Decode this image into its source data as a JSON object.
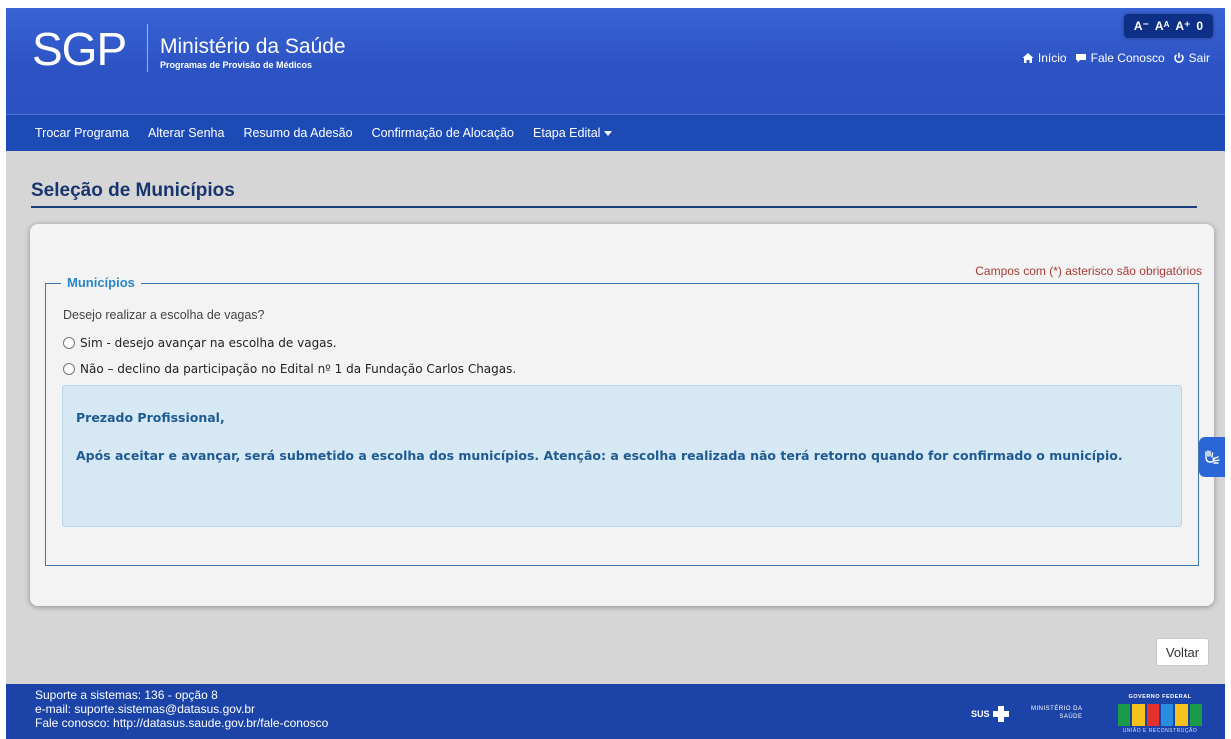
{
  "header": {
    "logo": "SGP",
    "title": "Ministério da Saúde",
    "subtitle": "Programas de Provisão de Médicos",
    "font_controls": [
      "A⁻",
      "Aᴬ",
      "A⁺",
      "0"
    ],
    "links": {
      "home": "Início",
      "contact": "Fale Conosco",
      "logout": "Sair"
    }
  },
  "nav": {
    "items": [
      "Trocar Programa",
      "Alterar Senha",
      "Resumo da Adesão",
      "Confirmação de Alocação",
      "Etapa Edital"
    ]
  },
  "page": {
    "title": "Seleção de Municípios",
    "required_note": "Campos com (*) asterisco são obrigatórios",
    "fieldset_legend": "Municípios",
    "question": "Desejo realizar a escolha de vagas?",
    "options": [
      "Sim - desejo avançar na escolha de vagas.",
      "Não – declino da participação no Edital nº 1 da Fundação Carlos Chagas."
    ],
    "alert": {
      "greeting": "Prezado Profissional,",
      "body": "Após aceitar e avançar, será submetido a escolha dos municípios.  Atenção: a escolha realizada não terá retorno quando for confirmado o município."
    },
    "back_button": "Voltar"
  },
  "footer": {
    "lines": [
      "Suporte a sistemas: 136 - opção 8",
      "e-mail: suporte.sistemas@datasus.gov.br",
      "Fale conosco: http://datasus.saude.gov.br/fale-conosco"
    ],
    "sus_label": "SUS",
    "ms_line1": "MINISTÉRIO DA",
    "ms_line2": "SAÚDE",
    "gov_top": "GOVERNO FEDERAL",
    "gov_bottom": "UNIÃO E RECONSTRUÇÃO"
  },
  "colors": {
    "header_blue": "#2c53c4",
    "nav_blue": "#1d4bb6",
    "title_navy": "#19356e",
    "legend_blue": "#2a86c9",
    "alert_bg": "#d5e8f3",
    "alert_text": "#1f5a93",
    "required_red": "#a63c34",
    "footer_blue": "#1c44a8"
  }
}
